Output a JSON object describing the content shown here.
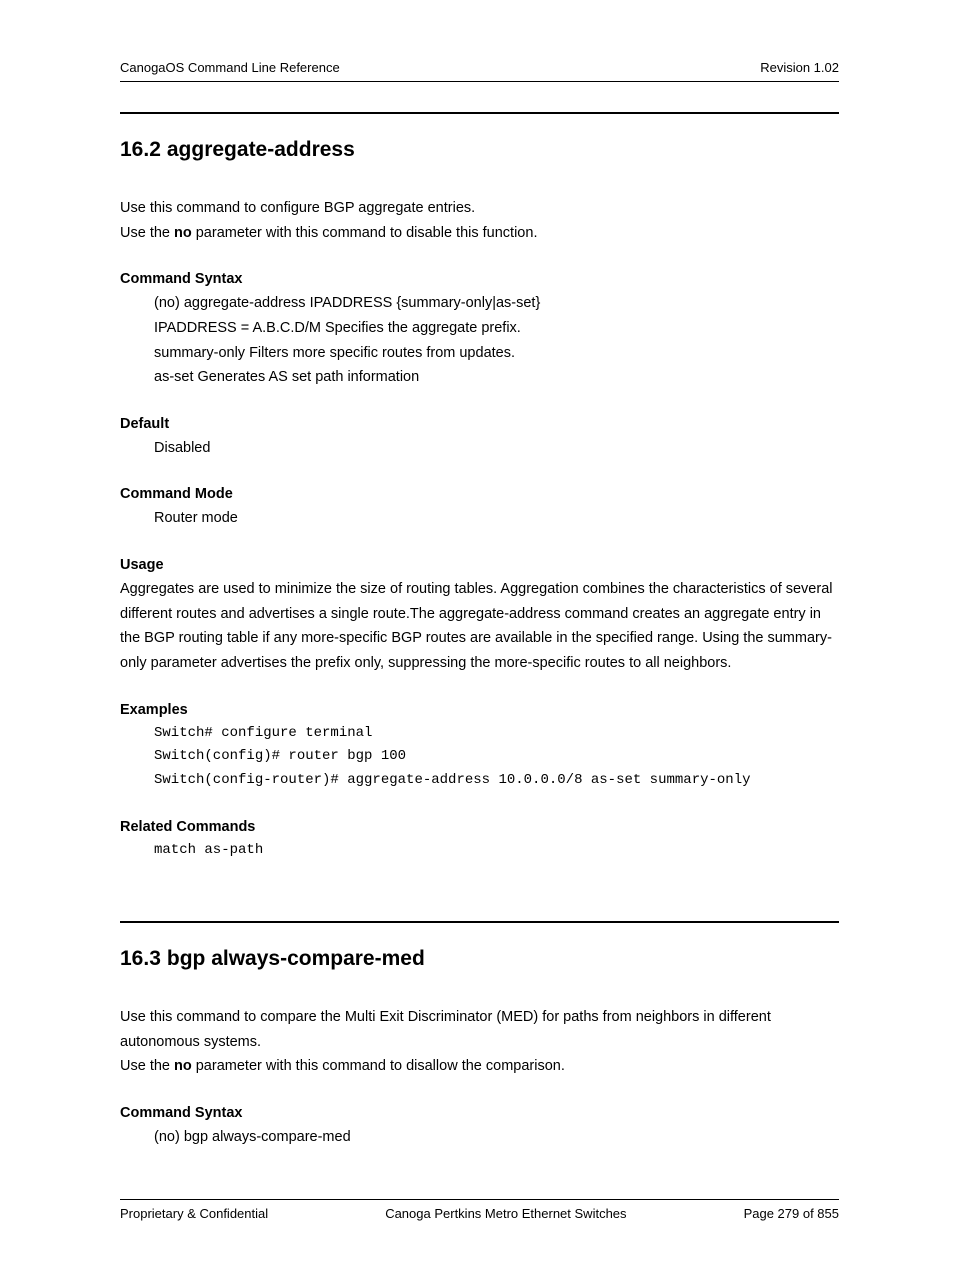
{
  "header": {
    "left": "CanogaOS Command Line Reference",
    "right": "Revision 1.02"
  },
  "section1": {
    "number": "16.2",
    "title": "aggregate-address",
    "intro_line1": "Use this command to configure BGP aggregate entries.",
    "intro_line2_a": "Use the ",
    "intro_line2_bold": "no",
    "intro_line2_b": " parameter with this command to disable this function.",
    "syntax_head": "Command Syntax",
    "syntax_l1": "(no) aggregate-address IPADDRESS {summary-only|as-set}",
    "syntax_l2": "IPADDRESS = A.B.C.D/M Specifies the aggregate prefix.",
    "syntax_l3": "summary-only Filters more specific routes from updates.",
    "syntax_l4": "as-set Generates AS set path information",
    "default_head": "Default",
    "default_body": "Disabled",
    "mode_head": "Command Mode",
    "mode_body": "Router mode",
    "usage_head": "Usage",
    "usage_body": "Aggregates are used to minimize the size of routing tables. Aggregation combines the characteristics of several different routes and advertises a single route.The aggregate-address command creates an aggregate entry in the BGP routing table if any more-specific BGP routes are available in the specified range. Using the summary-only parameter advertises the prefix only, suppressing the more-specific routes to all neighbors.",
    "examples_head": "Examples",
    "ex_l1": "Switch# configure terminal",
    "ex_l2": "Switch(config)# router bgp 100",
    "ex_l3": "Switch(config-router)# aggregate-address 10.0.0.0/8 as-set summary-only",
    "related_head": "Related Commands",
    "related_body": "match as-path"
  },
  "section2": {
    "number": "16.3",
    "title": "bgp always-compare-med",
    "intro_line1": "Use this command to compare the Multi Exit Discriminator (MED) for paths from neighbors in different autonomous systems.",
    "intro_line2_a": "Use the ",
    "intro_line2_bold": "no",
    "intro_line2_b": " parameter with this command to disallow the comparison.",
    "syntax_head": "Command Syntax",
    "syntax_l1": "(no) bgp always-compare-med"
  },
  "footer": {
    "left": "Proprietary & Confidential",
    "center": "Canoga Pertkins Metro Ethernet Switches",
    "right": "Page 279 of 855"
  }
}
